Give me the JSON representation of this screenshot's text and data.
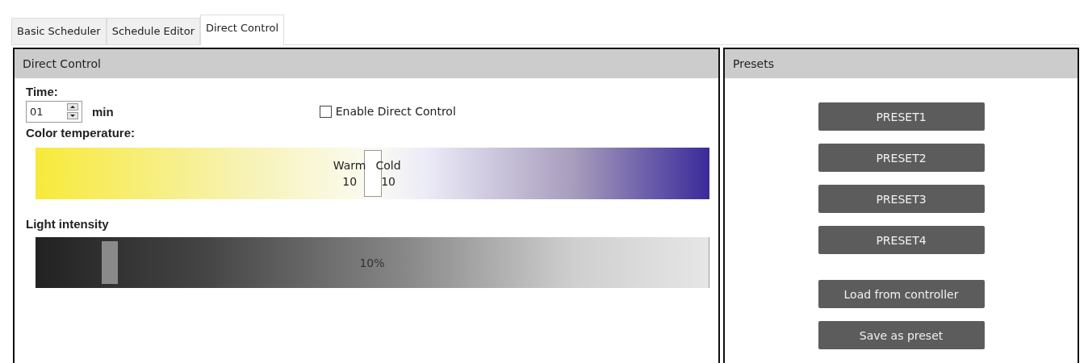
{
  "tabs": [
    {
      "label": "Basic Scheduler",
      "selected": false
    },
    {
      "label": "Schedule Editor",
      "selected": false
    },
    {
      "label": "Direct Control",
      "selected": true
    }
  ],
  "direct_control": {
    "title": "Direct Control",
    "time_label": "Time:",
    "time_value": "01",
    "time_unit": "min",
    "enable": {
      "label": "Enable Direct Control",
      "checked": false
    },
    "color_temperature": {
      "label": "Color temperature:",
      "warm_label": "Warm",
      "warm_value": "10",
      "cold_label": "Cold",
      "cold_value": "10",
      "level": 0.5
    },
    "light_intensity": {
      "label": "Light intensity",
      "reading": "10%",
      "level": 0.11
    }
  },
  "presets": {
    "title": "Presets",
    "preset_buttons": [
      "PRESET1",
      "PRESET2",
      "PRESET3",
      "PRESET4"
    ],
    "action_buttons": [
      "Load from controller",
      "Save as preset"
    ]
  }
}
